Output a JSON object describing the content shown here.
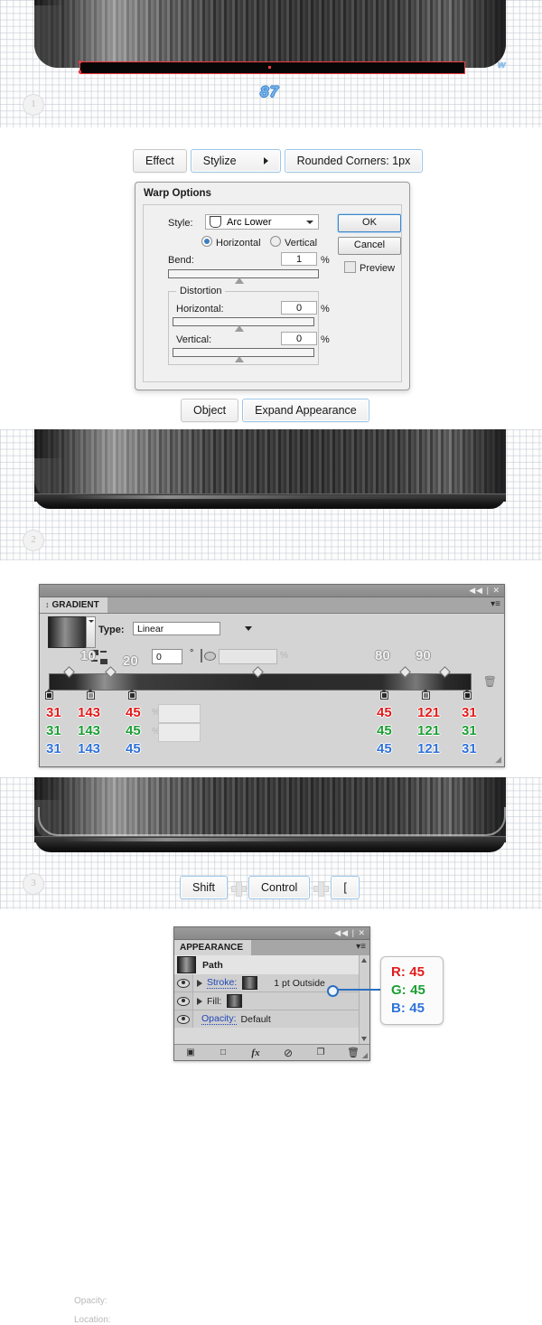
{
  "steps": [
    {
      "num": "1"
    },
    {
      "num": "2"
    },
    {
      "num": "3"
    }
  ],
  "artwork_1": {
    "measure_label": "87",
    "corner_label": "w"
  },
  "menu_row_effect": {
    "items": [
      {
        "label": "Effect",
        "style": "plain"
      },
      {
        "label": "Stylize",
        "style": "blue",
        "arrow": "submenu-arrow"
      },
      {
        "label": "Rounded Corners: 1px",
        "style": "blue"
      }
    ]
  },
  "warp_dialog": {
    "title": "Warp Options",
    "style_label": "Style:",
    "style_value": "Arc Lower",
    "orientation": {
      "horizontal": "Horizontal",
      "vertical": "Vertical",
      "selected": "Horizontal"
    },
    "bend": {
      "label": "Bend:",
      "value": "1",
      "unit": "%"
    },
    "distortion": {
      "title": "Distortion",
      "horizontal": {
        "label": "Horizontal:",
        "value": "0",
        "unit": "%"
      },
      "vertical": {
        "label": "Vertical:",
        "value": "0",
        "unit": "%"
      }
    },
    "buttons": {
      "ok": "OK",
      "cancel": "Cancel",
      "preview": "Preview"
    }
  },
  "menu_row_object": {
    "items": [
      {
        "label": "Object",
        "style": "plain"
      },
      {
        "label": "Expand Appearance",
        "style": "blue"
      }
    ]
  },
  "gradient_panel": {
    "tab_label": "GRADIENT",
    "type_label": "Type:",
    "type_value": "Linear",
    "angle_value": "0",
    "angle_unit": "°",
    "aspect_value": "",
    "aspect_unit": "%",
    "ghost_labels": {
      "opacity": "Opacity:",
      "location": "Location:"
    },
    "position_labels": [
      "10",
      "20",
      "80",
      "90"
    ],
    "stops": [
      {
        "position": 0,
        "r": "31",
        "g": "31",
        "b": "31",
        "color": "#1f1f1f"
      },
      {
        "position": 10,
        "r": "143",
        "g": "143",
        "b": "143",
        "color": "#8f8f8f"
      },
      {
        "position": 20,
        "r": "45",
        "g": "45",
        "b": "45",
        "color": "#2d2d2d"
      },
      {
        "position": 80,
        "r": "45",
        "g": "45",
        "b": "45",
        "color": "#2d2d2d"
      },
      {
        "position": 90,
        "r": "121",
        "g": "121",
        "b": "121",
        "color": "#797979"
      },
      {
        "position": 100,
        "r": "31",
        "g": "31",
        "b": "31",
        "color": "#1f1f1f"
      }
    ],
    "panel_controls": "◀◀ | ✕"
  },
  "shortcut_row": {
    "keys": [
      "Shift",
      "Control",
      "["
    ]
  },
  "appearance_panel": {
    "tab_label": "APPEARANCE",
    "target_label": "Path",
    "rows": [
      {
        "name": "stroke",
        "label": "Stroke:",
        "value": "1 pt  Outside"
      },
      {
        "name": "fill",
        "label": "Fill:",
        "value": ""
      },
      {
        "name": "opacity",
        "label": "Opacity:",
        "value": "Default"
      }
    ],
    "bottom_icons": [
      {
        "name": "add-new-stroke-icon",
        "glyph": "▣"
      },
      {
        "name": "add-new-fill-icon",
        "glyph": "□"
      },
      {
        "name": "add-new-effect-icon",
        "glyph": "fx"
      },
      {
        "name": "clear-appearance-icon",
        "glyph": "⊘"
      },
      {
        "name": "duplicate-item-icon",
        "glyph": "❐"
      },
      {
        "name": "delete-item-icon",
        "glyph": "Ὕ1"
      }
    ],
    "panel_controls": "◀◀ | ✕"
  },
  "color_callout": {
    "r_label": "R:",
    "r_value": "45",
    "g_label": "G:",
    "g_value": "45",
    "b_label": "B:",
    "b_value": "45"
  },
  "colors": {
    "red": "#e01b1b",
    "green": "#1c9e34",
    "blue": "#2f72d8",
    "selection": "#ef3b41",
    "accent": "#2b6fc0"
  }
}
